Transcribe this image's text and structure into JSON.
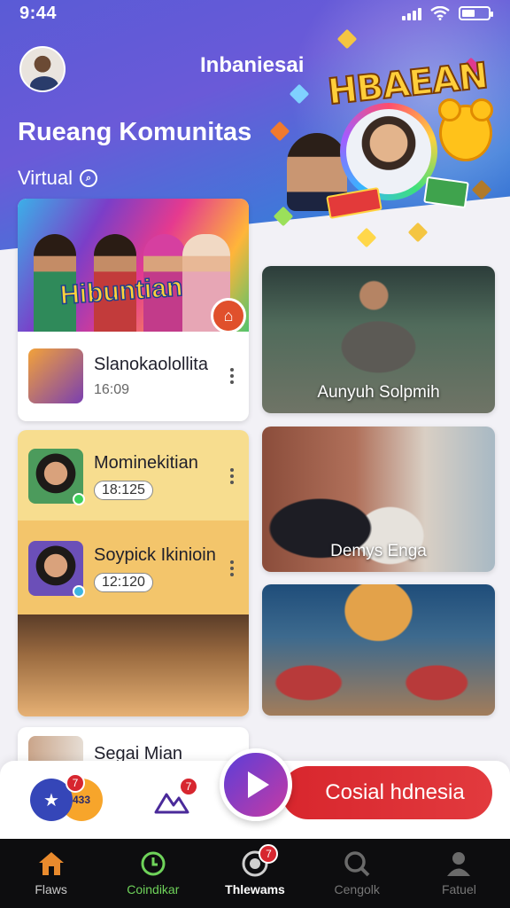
{
  "status": {
    "time": "9:44"
  },
  "header": {
    "brand": "Inbaniesai",
    "title": "Rueang Komunitas",
    "section_label": "Virtual",
    "banner_title": "HBAEAN"
  },
  "featured": {
    "logo_text": "Hibuntian",
    "list": [
      {
        "name": "Slanokaolollita",
        "time": "16:09",
        "time_style": "plain"
      }
    ]
  },
  "highlight_list": [
    {
      "name": "Mominekitian",
      "time": "18:125"
    },
    {
      "name": "Soypick Ikinioin",
      "time": "12:120"
    }
  ],
  "small_list": [
    {
      "name": "Segai Mian"
    }
  ],
  "right_column": [
    {
      "caption": "Aunyuh Solpmih"
    },
    {
      "caption": "Demys Enga"
    },
    {
      "caption": ""
    }
  ],
  "action_bar": {
    "left_badge": "7",
    "left_chip": "433",
    "mid_badge": "7",
    "cta_label": "Cosial hdnesia"
  },
  "nav": [
    {
      "label": "Flaws",
      "icon": "home-icon"
    },
    {
      "label": "Coindikar",
      "icon": "clock-icon"
    },
    {
      "label": "Thlewams",
      "icon": "live-icon",
      "badge": "7"
    },
    {
      "label": "Cengolk",
      "icon": "search-icon"
    },
    {
      "label": "Fatuel",
      "icon": "profile-icon"
    }
  ],
  "colors": {
    "header_gradient": [
      "#5a5bd6",
      "#2a63c9"
    ],
    "cta": "#d8262d",
    "play": [
      "#5b3ed8",
      "#c63aa4"
    ],
    "nav_bg": "#0d0d0f",
    "nav_active_green": "#6fd35a"
  }
}
